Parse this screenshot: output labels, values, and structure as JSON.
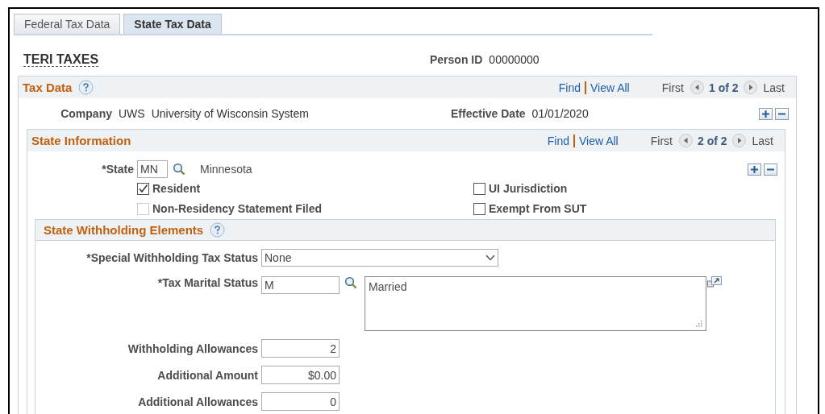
{
  "tabs": [
    {
      "label": "Federal Tax Data",
      "selected": false
    },
    {
      "label": "State Tax Data",
      "selected": true
    }
  ],
  "employee_name": "TERI TAXES",
  "person_id": {
    "label": "Person ID",
    "value": "00000000"
  },
  "tax_data": {
    "title": "Tax Data",
    "nav": {
      "find": "Find",
      "view_all": "View All",
      "first": "First",
      "position": "1 of 2",
      "last": "Last"
    },
    "company": {
      "label": "Company",
      "code": "UWS",
      "name": "University of Wisconsin System"
    },
    "effective_date": {
      "label": "Effective Date",
      "value": "01/01/2020"
    },
    "state_information": {
      "title": "State Information",
      "nav": {
        "find": "Find",
        "view_all": "View All",
        "first": "First",
        "position": "2 of 2",
        "last": "Last"
      },
      "state": {
        "label": "*State",
        "value": "MN",
        "description": "Minnesota"
      },
      "checkboxes": [
        {
          "label": "Resident",
          "checked": true,
          "disabled": false
        },
        {
          "label": "UI Jurisdiction",
          "checked": false,
          "disabled": false
        },
        {
          "label": "Non-Residency Statement Filed",
          "checked": false,
          "disabled": true
        },
        {
          "label": "Exempt From SUT",
          "checked": false,
          "disabled": false
        }
      ],
      "withholding": {
        "title": "State Withholding Elements",
        "fields": [
          {
            "kind": "select",
            "label": "*Special Withholding Tax Status",
            "value": "None"
          },
          {
            "kind": "lookup",
            "label": "*Tax Marital Status",
            "value": "M",
            "description": "Married"
          },
          {
            "kind": "number",
            "label": "Withholding Allowances",
            "value": "2"
          },
          {
            "kind": "number",
            "label": "Additional Amount",
            "value": "$0.00"
          },
          {
            "kind": "number",
            "label": "Additional Allowances",
            "value": "0"
          }
        ]
      }
    }
  }
}
